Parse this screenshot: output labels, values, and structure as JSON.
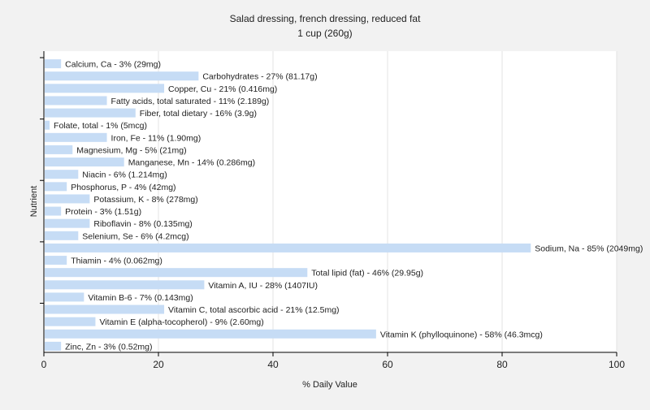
{
  "chart_data": {
    "type": "bar",
    "orientation": "horizontal",
    "title": "Salad dressing, french dressing, reduced fat",
    "subtitle": "1 cup (260g)",
    "xlabel": "% Daily Value",
    "ylabel": "Nutrient",
    "xlim": [
      0,
      100
    ],
    "xticks": [
      0,
      20,
      40,
      60,
      80,
      100
    ],
    "grid": true,
    "legend": "none",
    "bar_color": "#c6dcf5",
    "categories": [
      "Calcium, Ca",
      "Carbohydrates",
      "Copper, Cu",
      "Fatty acids, total saturated",
      "Fiber, total dietary",
      "Folate, total",
      "Iron, Fe",
      "Magnesium, Mg",
      "Manganese, Mn",
      "Niacin",
      "Phosphorus, P",
      "Potassium, K",
      "Protein",
      "Riboflavin",
      "Selenium, Se",
      "Sodium, Na",
      "Thiamin",
      "Total lipid (fat)",
      "Vitamin A, IU",
      "Vitamin B-6",
      "Vitamin C, total ascorbic acid",
      "Vitamin E (alpha-tocopherol)",
      "Vitamin K (phylloquinone)",
      "Zinc, Zn"
    ],
    "values": [
      3,
      27,
      21,
      11,
      16,
      1,
      11,
      5,
      14,
      6,
      4,
      8,
      3,
      8,
      6,
      85,
      4,
      46,
      28,
      7,
      21,
      9,
      58,
      3
    ],
    "labels": [
      "Calcium, Ca - 3% (29mg)",
      "Carbohydrates - 27% (81.17g)",
      "Copper, Cu - 21% (0.416mg)",
      "Fatty acids, total saturated - 11% (2.189g)",
      "Fiber, total dietary - 16% (3.9g)",
      "Folate, total - 1% (5mcg)",
      "Iron, Fe - 11% (1.90mg)",
      "Magnesium, Mg - 5% (21mg)",
      "Manganese, Mn - 14% (0.286mg)",
      "Niacin - 6% (1.214mg)",
      "Phosphorus, P - 4% (42mg)",
      "Potassium, K - 8% (278mg)",
      "Protein - 3% (1.51g)",
      "Riboflavin - 8% (0.135mg)",
      "Selenium, Se - 6% (4.2mcg)",
      "Sodium, Na - 85% (2049mg)",
      "Thiamin - 4% (0.062mg)",
      "Total lipid (fat) - 46% (29.95g)",
      "Vitamin A, IU - 28% (1407IU)",
      "Vitamin B-6 - 7% (0.143mg)",
      "Vitamin C, total ascorbic acid - 21% (12.5mg)",
      "Vitamin E (alpha-tocopherol) - 9% (2.60mg)",
      "Vitamin K (phylloquinone) - 58% (46.3mcg)",
      "Zinc, Zn - 3% (0.52mg)"
    ]
  }
}
